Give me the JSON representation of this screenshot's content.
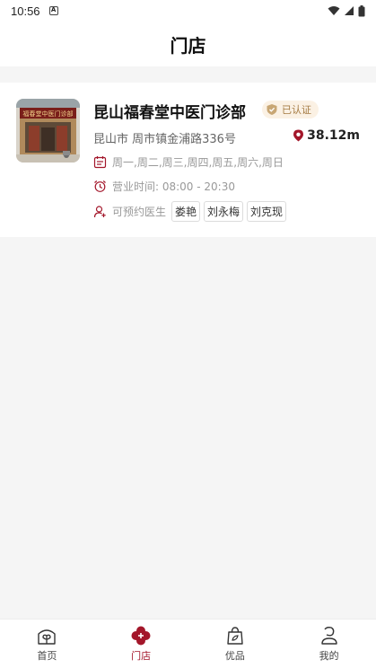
{
  "status_bar": {
    "time": "10:56",
    "notification_icon": "A"
  },
  "app_bar": {
    "title": "门店"
  },
  "store": {
    "name": "昆山福春堂中医门诊部",
    "verified_label": "已认证",
    "address": "昆山市 周市镇金浦路336号",
    "distance": "38.12m",
    "open_days": "周一,周二,周三,周四,周五,周六,周日",
    "hours": "营业时间: 08:00 - 20:30",
    "doctors_label": "可预约医生",
    "doctors": [
      "娄艳",
      "刘永梅",
      "刘克现"
    ],
    "signboard_text": "福春堂中医门诊部"
  },
  "tabs": [
    {
      "label": "首页",
      "icon": "home-leaf-icon",
      "active": false
    },
    {
      "label": "门店",
      "icon": "store-flower-icon",
      "active": true
    },
    {
      "label": "优品",
      "icon": "shopping-bag-icon",
      "active": false
    },
    {
      "label": "我的",
      "icon": "profile-icon",
      "active": false
    }
  ],
  "colors": {
    "accent": "#a3162a",
    "badge_bg": "#fbf1e4",
    "badge_text": "#a57b43"
  }
}
